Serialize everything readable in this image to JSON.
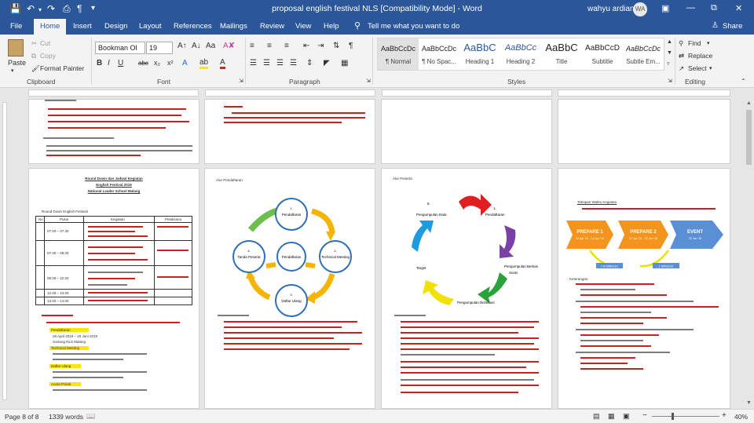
{
  "window": {
    "title": "proposal english festival NLS [Compatibility Mode]  -  Word",
    "user_name": "wahyu ardian",
    "user_initials": "WA"
  },
  "quick_access": {
    "save_icon": "save-icon",
    "undo_icon": "undo-icon",
    "redo_icon": "redo-icon"
  },
  "menu": {
    "tabs": [
      "File",
      "Home",
      "Insert",
      "Design",
      "Layout",
      "References",
      "Mailings",
      "Review",
      "View",
      "Help"
    ],
    "tell_me": "Tell me what you want to do",
    "share": "Share"
  },
  "ribbon": {
    "clipboard": {
      "paste": "Paste",
      "cut": "Cut",
      "copy": "Copy",
      "format_painter": "Format Painter",
      "label": "Clipboard"
    },
    "font": {
      "font_name": "Bookman Ol",
      "font_size": "19",
      "label": "Font"
    },
    "paragraph": {
      "label": "Paragraph"
    },
    "styles": {
      "label": "Styles",
      "items": [
        {
          "preview": "AaBbCcDc",
          "name": "¶ Normal"
        },
        {
          "preview": "AaBbCcDc",
          "name": "¶ No Spac..."
        },
        {
          "preview": "AaBbC",
          "name": "Heading 1"
        },
        {
          "preview": "AaBbCc",
          "name": "Heading 2"
        },
        {
          "preview": "AaBbC",
          "name": "Title"
        },
        {
          "preview": "AaBbCcD",
          "name": "Subtitle"
        },
        {
          "preview": "AaBbCcDc",
          "name": "Subtle Em..."
        }
      ]
    },
    "editing": {
      "find": "Find",
      "replace": "Replace",
      "select": "Select",
      "label": "Editing"
    }
  },
  "document": {
    "page3": {
      "title1": "Round Down dan Jadwal Kegiatan",
      "title2": "English Festival 2019",
      "title3": "National Leader School Malang",
      "rundown": "Round Down English Festival",
      "col_no": "No",
      "col_pukul": "Pukul",
      "col_kegiatan": "Kegiatan",
      "col_pelaksana": "Pelaksana",
      "times": [
        "07.00 – 07.30",
        "07.30 – 08.00",
        "08.00 – 12.00",
        "12.00 – 13.00",
        "13.00 – 14.00"
      ],
      "item1": "Pendaftaran",
      "item1_date": "29 April 2019 – 20 Juni 2019",
      "place": "Gedung NLS Malang",
      "item2": "Technical Meeting",
      "item3": "Daftar Ulang",
      "item4": "Acara Pokok"
    },
    "page4": {
      "heading": "Alur Pendaftaran",
      "nodes": [
        "Pendaftaran",
        "Technical Meeting",
        "Daftar Ulang",
        "Tanda Peserta",
        "Pendaftaran"
      ]
    },
    "page5": {
      "heading": "Alur Peserta",
      "nodes": [
        "Pendaftaran",
        "Pengumpulan Berkas",
        "Pengumpulan Data",
        "Pengumpulan Berkas Surat",
        "Pengumpulan Distribusi",
        "Target"
      ]
    },
    "page6": {
      "heading": "Tahapan Waktu Kegiatan",
      "stages": [
        "PREPARE 1",
        "PREPARE 2",
        "EVENT"
      ],
      "stage_dates": [
        "22 Apr '19 – 14 Jun '19",
        "17 Jun '19 – 21 Jun '19",
        "22 Jun '19"
      ],
      "durations": [
        "7-8 MINGGU",
        "1 MINGGU"
      ],
      "note_title": "Keterangan:"
    }
  },
  "status": {
    "page": "Page 8 of 8",
    "words": "1339 words",
    "zoom": "40%"
  },
  "colors": {
    "brand": "#2b579a",
    "arrow_red": "#e02020",
    "arrow_purple": "#7b3fa8",
    "arrow_green": "#29a33a",
    "arrow_yellow": "#f2e000",
    "arrow_blue": "#1e9be0",
    "circle_blue": "#2f6fb5",
    "cycle_yellow": "#f4b400",
    "cycle_green": "#6bbf4a",
    "prepare_orange": "#f3941e",
    "event_blue": "#5a8fd6"
  }
}
